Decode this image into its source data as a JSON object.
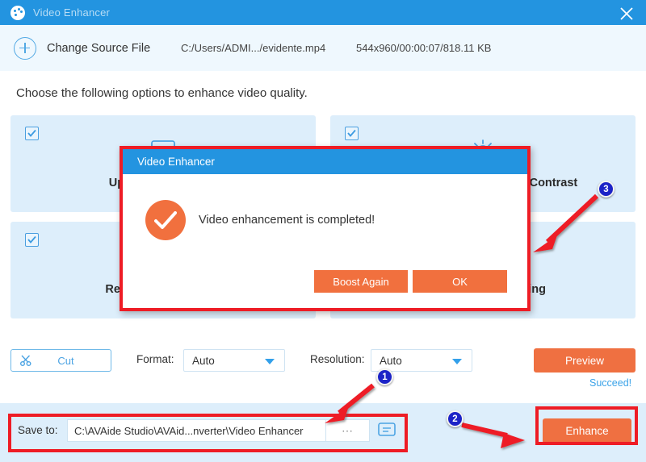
{
  "window": {
    "title": "Video Enhancer",
    "app_icon": "palette-icon",
    "close_icon": "close-icon",
    "titlebar_color": "#2394e0"
  },
  "source_bar": {
    "add_icon": "plus-circle-icon",
    "change_source_label": "Change Source File",
    "file_path": "C:/Users/ADMI.../evidente.mp4",
    "file_meta": "544x960/00:00:07/818.11 KB"
  },
  "main": {
    "instruction": "Choose the following options to enhance video quality.",
    "options": [
      {
        "label": "Upscale Resolution",
        "icon": "monitor-icon",
        "checked": true
      },
      {
        "label": "Optimize Brightness and Contrast",
        "icon": "brightness-icon",
        "checked": true
      },
      {
        "label": "Remove Video Noise",
        "icon": "noise-icon",
        "checked": true
      },
      {
        "label": "Reduce Video Shaking",
        "icon": "shake-icon",
        "checked": true
      }
    ]
  },
  "toolbar": {
    "cut_label": "Cut",
    "cut_icon": "scissors-icon",
    "format_label": "Format:",
    "format_value": "Auto",
    "resolution_label": "Resolution:",
    "resolution_value": "Auto",
    "dropdown_icon": "chevron-down-icon",
    "preview_label": "Preview",
    "succeed_label": "Succeed!"
  },
  "save_bar": {
    "save_to_label": "Save to:",
    "save_path": "C:\\AVAide Studio\\AVAid...nverter\\Video Enhancer",
    "browse_label": "⋯",
    "open_folder_icon": "folder-open-icon",
    "enhance_label": "Enhance"
  },
  "dialog": {
    "title": "Video Enhancer",
    "status_icon": "check-circle-icon",
    "message": "Video enhancement is completed!",
    "boost_again_label": "Boost Again",
    "ok_label": "OK"
  },
  "annotations": {
    "badges": [
      "1",
      "2",
      "3"
    ],
    "highlight_color": "#ee1c25",
    "badge_color": "#1c23c7"
  },
  "colors": {
    "accent_blue": "#2394e0",
    "accent_orange": "#ef7041",
    "card_bg": "#ddeefb",
    "link_blue": "#3ba3e8"
  }
}
